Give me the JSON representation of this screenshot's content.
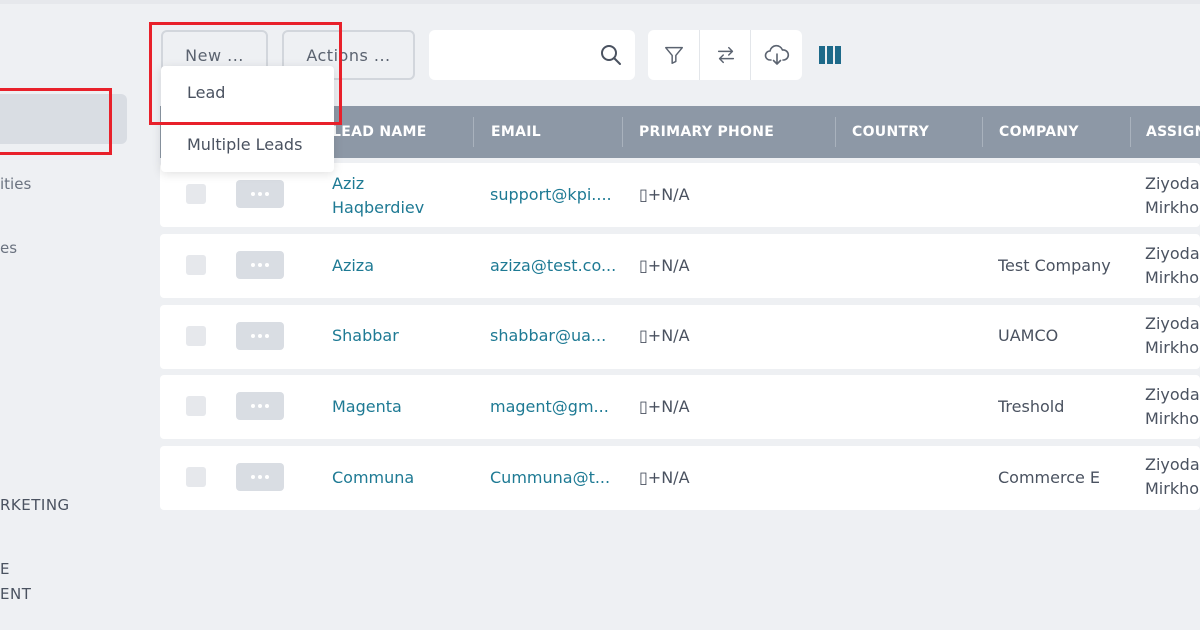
{
  "sidebar": {
    "items": [
      {
        "label": "ities"
      },
      {
        "label": "es"
      },
      {
        "label": "RKETING"
      },
      {
        "label": "E"
      },
      {
        "label": "ENT"
      }
    ]
  },
  "toolbar": {
    "new_label": "New ...",
    "actions_label": "Actions ...",
    "search_value": "",
    "icons": [
      "filter-icon",
      "swap-icon",
      "download-cloud-icon",
      "columns-icon"
    ]
  },
  "new_menu": {
    "items": [
      {
        "label": "Lead"
      },
      {
        "label": "Multiple Leads"
      }
    ]
  },
  "table": {
    "columns": [
      "LEAD NAME",
      "EMAIL",
      "PRIMARY PHONE",
      "COUNTRY",
      "COMPANY",
      "ASSIGN"
    ],
    "rows": [
      {
        "name_line1": "Aziz",
        "name_line2": "Haqberdiev",
        "email": "support@kpi....",
        "phone": "▯+N/A",
        "country": "",
        "company": "",
        "assign1": "Ziyoda",
        "assign2": "Mirkho"
      },
      {
        "name_line1": "Aziza",
        "name_line2": "",
        "email": "aziza@test.co...",
        "phone": "▯+N/A",
        "country": "",
        "company": "Test Company",
        "assign1": "Ziyoda",
        "assign2": "Mirkho"
      },
      {
        "name_line1": "Shabbar",
        "name_line2": "",
        "email": "shabbar@ua...",
        "phone": "▯+N/A",
        "country": "",
        "company": "UAMCO",
        "assign1": "Ziyoda",
        "assign2": "Mirkho"
      },
      {
        "name_line1": "Magenta",
        "name_line2": "",
        "email": "magent@gm...",
        "phone": "▯+N/A",
        "country": "",
        "company": "Treshold",
        "assign1": "Ziyoda",
        "assign2": "Mirkho"
      },
      {
        "name_line1": "Communa",
        "name_line2": "",
        "email": "Cummuna@t...",
        "phone": "▯+N/A",
        "country": "",
        "company": "Commerce E",
        "assign1": "Ziyoda",
        "assign2": "Mirkho"
      }
    ]
  },
  "colors": {
    "header_bg": "#8d98a6",
    "link": "#1e7a94",
    "highlight": "#e8202a",
    "page_bg": "#eef0f3"
  }
}
